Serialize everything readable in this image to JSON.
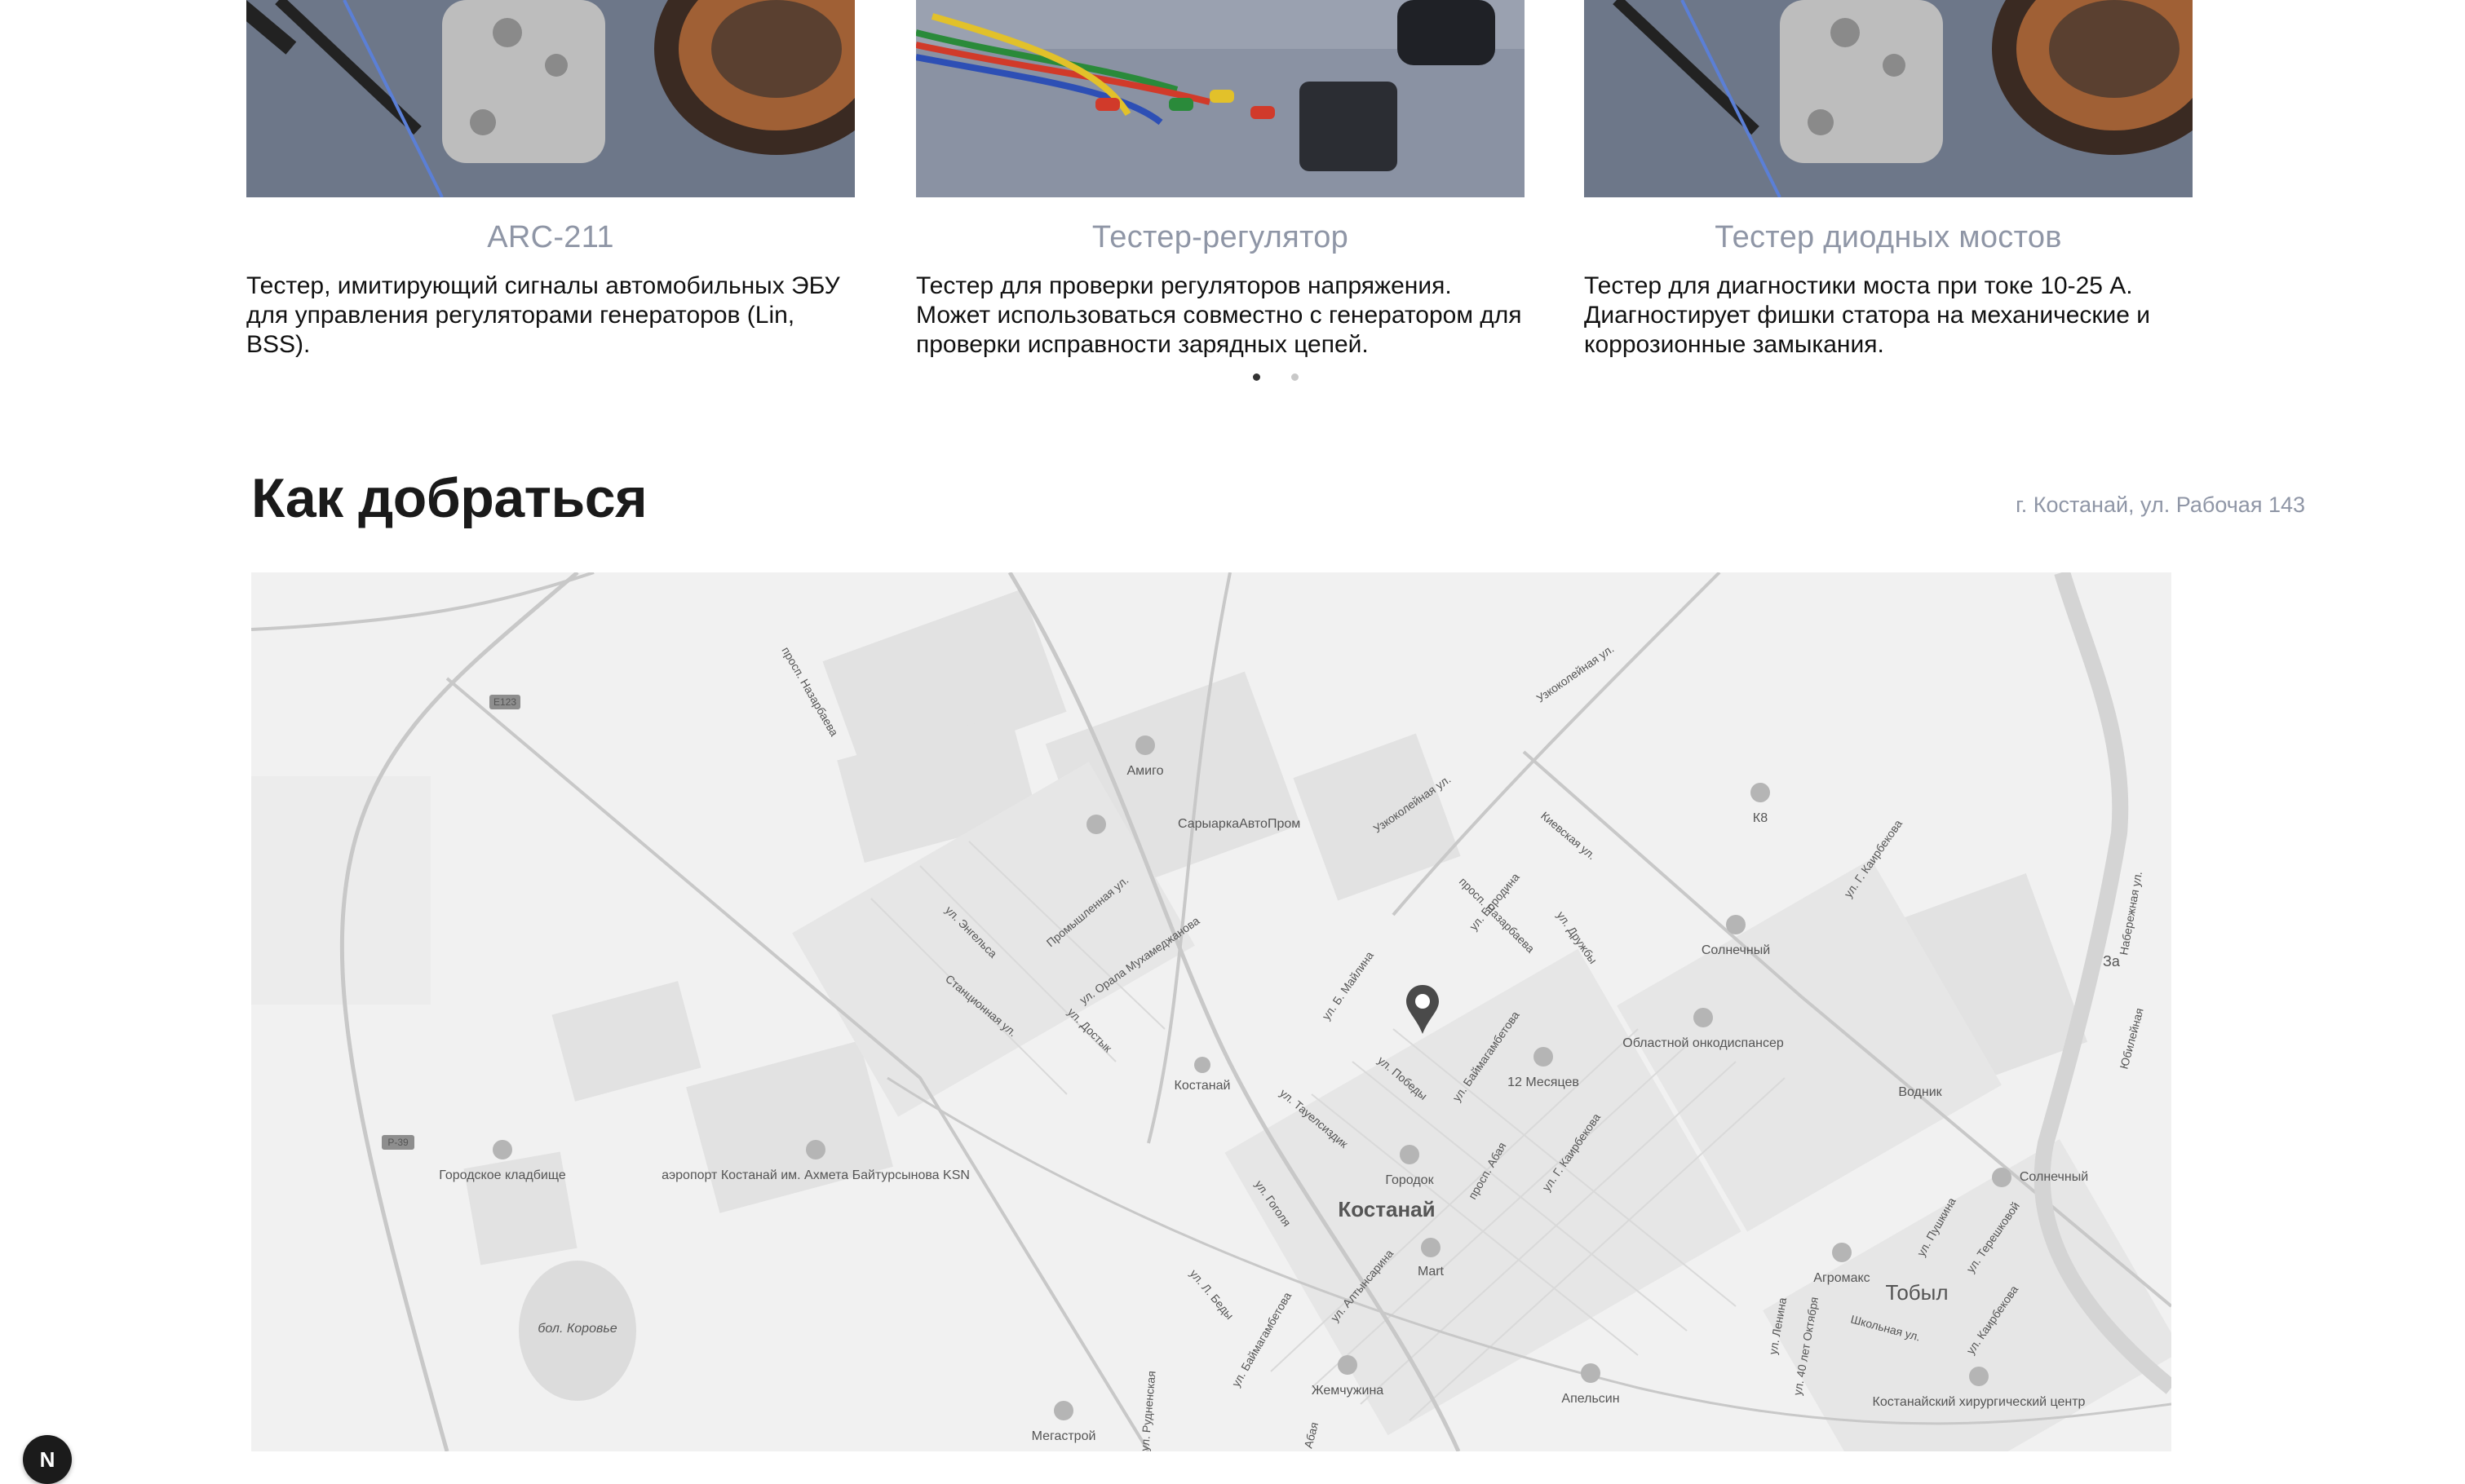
{
  "products": [
    {
      "title": "ARC-211",
      "description": "Тестер, имитирующий сигналы автомобильных ЭБУ для управления регуляторами генераторов (Lin, BSS)."
    },
    {
      "title": "Тестер-регулятор",
      "description": "Тестер для проверки регуляторов напряжения. Может использоваться совместно с генератором для проверки исправности зарядных цепей."
    },
    {
      "title": "Тестер диодных мостов",
      "description": "Тестер для диагностики моста при токе 10-25 А. Диагностирует фишки статора на механические и коррозионные замыкания."
    }
  ],
  "carousel": {
    "page_count": 2,
    "active_index": 0
  },
  "location": {
    "heading": "Как добраться",
    "address": "г. Костанай, ул. Рабочая 143"
  },
  "map": {
    "road_shields": [
      "E123",
      "P-39"
    ],
    "city_label": "Костанай",
    "district_label": "Тобыл",
    "street_labels": [
      "просп. Назарбаева",
      "Узкоколейная ул.",
      "Киевская ул.",
      "ул. Г. Каирбекова",
      "Набережная ул.",
      "Промышленная ул.",
      "ул. Энгельса",
      "Станционная ул.",
      "ул. Орала Мухамеджанова",
      "ул. Достык",
      "ул. Бородина",
      "ул. Дружбы",
      "ул. Б. Майлина",
      "ул. Победы",
      "ул. Тауелсиздик",
      "ул. Баймагамбетова",
      "просп. Абая",
      "ул. Гоголя",
      "ул. Л. Беды",
      "ул. Алтынсарина",
      "ул. Ленина",
      "ул. 40 лет Октября",
      "Школьная ул.",
      "ул. Пушкина",
      "ул. Терешковой",
      "ул. Каирбекова",
      "ул. Рудненская",
      "Абая",
      "Юбилейная",
      "За"
    ],
    "poi_labels": [
      "Амиго",
      "СарыаркаАвтоПром",
      "К8",
      "Солнечный",
      "Областной онкодиспансер",
      "12 Месяцев",
      "Костанай",
      "Городок",
      "Mart",
      "Водник",
      "Солнечный",
      "Агромакс",
      "Городское кладбище",
      "аэропорт Костанай им. Ахмета Байтурсынова KSN",
      "бол. Коровье",
      "Мегастрой",
      "Жемчужина",
      "Апельсин",
      "Костанайский хирургический центр"
    ]
  },
  "fab": {
    "label": "N"
  },
  "colors": {
    "accent_title": "#8f96a6",
    "text": "#1a1a1a",
    "map_bg": "#efefef"
  }
}
